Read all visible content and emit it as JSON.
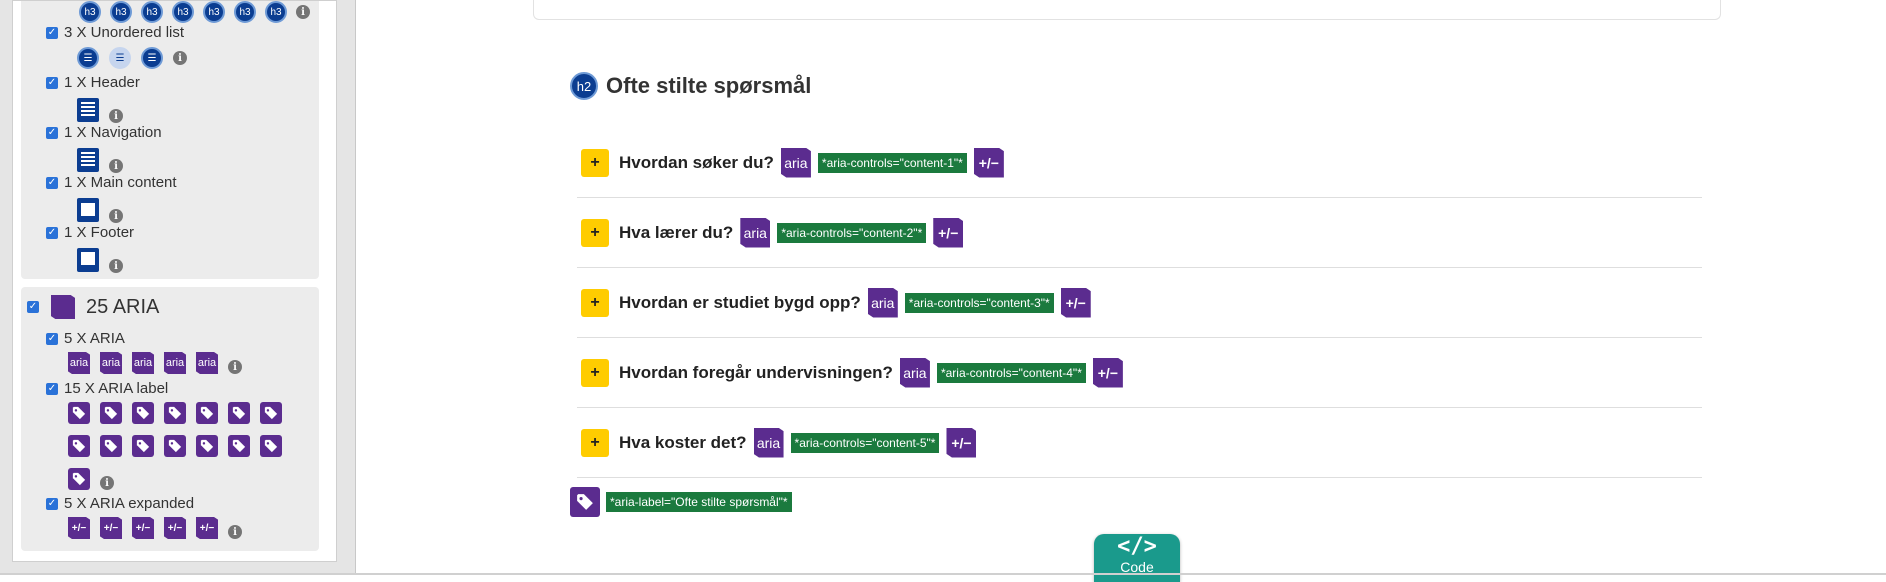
{
  "sidebar": {
    "items": [
      {
        "label": "3 X Unordered list",
        "checked": true
      },
      {
        "label": "1 X Header",
        "checked": true
      },
      {
        "label": "1 X Navigation",
        "checked": true
      },
      {
        "label": "1 X Main content",
        "checked": true
      },
      {
        "label": "1 X Footer",
        "checked": true
      }
    ],
    "h3_icon_label": "h3",
    "aria_group": {
      "title": "25 ARIA",
      "checked": true,
      "items": [
        {
          "label": "5 X ARIA",
          "checked": true
        },
        {
          "label": "15 X ARIA label",
          "checked": true
        },
        {
          "label": "5 X ARIA expanded",
          "checked": true
        }
      ],
      "aria_icon_label": "aria",
      "expanded_icon_label": "+/−"
    },
    "info_glyph": "i"
  },
  "main": {
    "heading_badge": "h2",
    "heading": "Ofte stilte spørsmål",
    "accordion": [
      {
        "question": "Hvordan søker du?",
        "controls": "*aria-controls=\"content-1\"*"
      },
      {
        "question": "Hva lærer du?",
        "controls": "*aria-controls=\"content-2\"*"
      },
      {
        "question": "Hvordan er studiet bygd opp?",
        "controls": "*aria-controls=\"content-3\"*"
      },
      {
        "question": "Hvordan foregår undervisningen?",
        "controls": "*aria-controls=\"content-4\"*"
      },
      {
        "question": "Hva koster det?",
        "controls": "*aria-controls=\"content-5\"*"
      }
    ],
    "plus_glyph": "+",
    "aria_badge": "aria",
    "expanded_badge": "+/−",
    "aria_label_pill": "*aria-label=\"Ofte stilte spørsmål\"*"
  },
  "code_button": {
    "glyph": "</>",
    "label": "Code"
  },
  "colors": {
    "aria_purple": "#5b2c8f",
    "html_blue": "#0b3d91",
    "pill_green": "#1b7a3e",
    "plus_yellow": "#ffcc00",
    "code_teal": "#1a9a8c"
  }
}
